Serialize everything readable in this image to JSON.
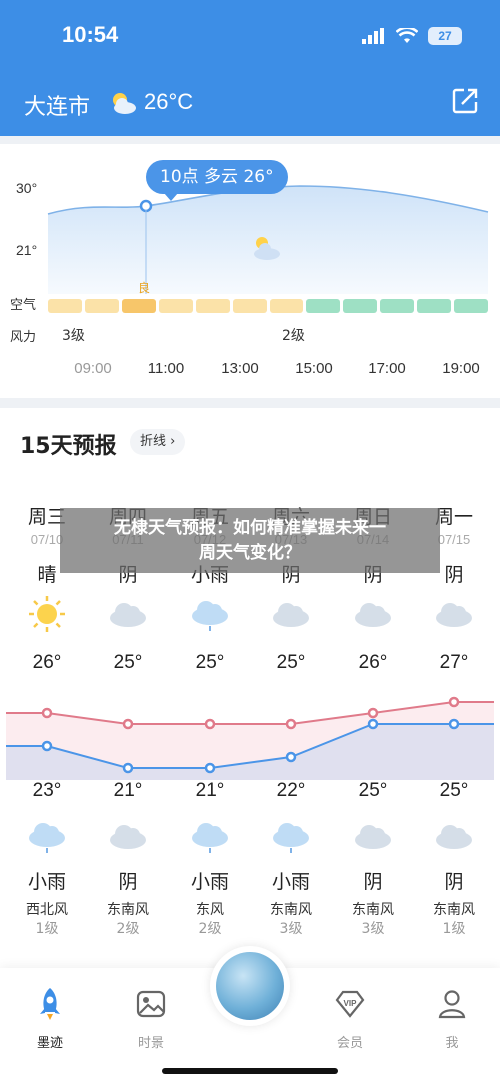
{
  "status_bar": {
    "time": "10:54",
    "battery": "27"
  },
  "header": {
    "city": "大连市",
    "temperature": "26°C"
  },
  "hourly": {
    "y_labels": [
      "30°",
      "21°"
    ],
    "row_labels": {
      "air": "空气",
      "wind": "风力"
    },
    "tooltip": "10点 多云 26°",
    "aqi_label": "良",
    "aqi_colors": {
      "good": "#f7c66a",
      "good_light": "#fbe2a8",
      "excellent": "#9ee0c4"
    },
    "wind_levels": [
      "3级",
      "2级"
    ],
    "hours": [
      "09:00",
      "11:00",
      "13:00",
      "15:00",
      "17:00",
      "19:00"
    ]
  },
  "daily": {
    "title": "15天预报",
    "chart_toggle": "折线",
    "days": [
      {
        "weekday": "周三",
        "date": "07/10",
        "cond_day": "晴",
        "high": "26°",
        "low": "23°",
        "cond_night": "小雨",
        "wind_dir": "西北风",
        "wind_level": "1级"
      },
      {
        "weekday": "周四",
        "date": "07/11",
        "cond_day": "阴",
        "high": "25°",
        "low": "21°",
        "cond_night": "阴",
        "wind_dir": "东南风",
        "wind_level": "2级"
      },
      {
        "weekday": "周五",
        "date": "07/12",
        "cond_day": "小雨",
        "high": "25°",
        "low": "21°",
        "cond_night": "小雨",
        "wind_dir": "东风",
        "wind_level": "2级"
      },
      {
        "weekday": "周六",
        "date": "07/13",
        "cond_day": "阴",
        "high": "25°",
        "low": "22°",
        "cond_night": "小雨",
        "wind_dir": "东南风",
        "wind_level": "3级"
      },
      {
        "weekday": "周日",
        "date": "07/14",
        "cond_day": "阴",
        "high": "26°",
        "low": "25°",
        "cond_night": "阴",
        "wind_dir": "东南风",
        "wind_level": "3级"
      },
      {
        "weekday": "周一",
        "date": "07/15",
        "cond_day": "阴",
        "high": "27°",
        "low": "25°",
        "cond_night": "阴",
        "wind_dir": "东南风",
        "wind_level": "1级"
      }
    ]
  },
  "overlay": {
    "line1": "无棣天气预报：如何精准掌握未来一",
    "line2": "周天气变化？"
  },
  "nav": {
    "items": [
      "墨迹",
      "时景",
      "会员",
      "我"
    ]
  },
  "colors": {
    "primary": "#3d8ee6",
    "high_line": "#e07a8a",
    "low_line": "#4b95e8"
  }
}
